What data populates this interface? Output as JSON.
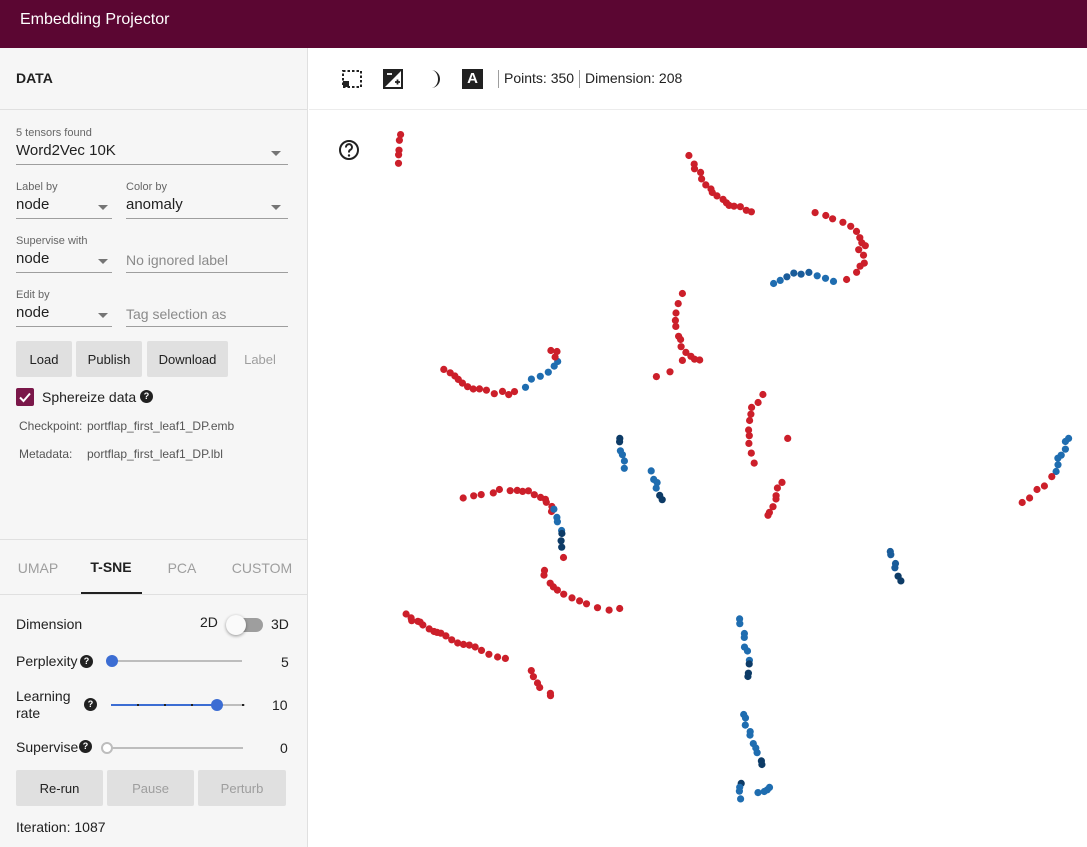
{
  "app": {
    "title": "Embedding Projector"
  },
  "data_panel": {
    "title": "DATA",
    "tensors": {
      "label": "5 tensors found",
      "value": "Word2Vec 10K"
    },
    "label_by": {
      "label": "Label by",
      "value": "node"
    },
    "color_by": {
      "label": "Color by",
      "value": "anomaly"
    },
    "supervise_with": {
      "label": "Supervise with",
      "value": "node"
    },
    "ignored_label": {
      "placeholder": "No ignored label"
    },
    "edit_by": {
      "label": "Edit by",
      "value": "node"
    },
    "tag_selection": {
      "placeholder": "Tag selection as"
    },
    "buttons": {
      "load": "Load",
      "publish": "Publish",
      "download": "Download",
      "label": "Label"
    },
    "sphereize": {
      "label": "Sphereize data",
      "checked": true,
      "help": "?"
    },
    "checkpoint": {
      "label": "Checkpoint:",
      "value": "portflap_first_leaf1_DP.emb"
    },
    "metadata": {
      "label": "Metadata:",
      "value": "portflap_first_leaf1_DP.lbl"
    }
  },
  "projection": {
    "tabs": [
      "UMAP",
      "T-SNE",
      "PCA",
      "CUSTOM"
    ],
    "active_tab": "T-SNE",
    "dimension": {
      "label": "Dimension",
      "opt_2d": "2D",
      "opt_3d": "3D",
      "selected": "2D"
    },
    "perplexity": {
      "label": "Perplexity",
      "value": "5",
      "fraction": 0.0
    },
    "learning_rate": {
      "label_line1": "Learning",
      "label_line2": "rate",
      "value": "10",
      "fraction": 0.8
    },
    "supervise": {
      "label": "Supervise",
      "value": "0",
      "fraction": 0.0
    },
    "buttons": {
      "rerun": "Re-run",
      "pause": "Pause",
      "perturb": "Perturb"
    },
    "iteration": "Iteration: 1087"
  },
  "toolbar": {
    "icons": [
      "selection-icon",
      "night-mode-icon",
      "moon-icon",
      "labels-icon"
    ],
    "labels_glyph": "A",
    "points": "Points: 350",
    "dimension": "Dimension: 208"
  },
  "plot_help": "?",
  "colors": {
    "brand": "#5b0632",
    "red": "#cc1f2a",
    "blue": "#1f6db0",
    "dark_blue": "#0d3b66",
    "accent": "#3c6dd3"
  }
}
